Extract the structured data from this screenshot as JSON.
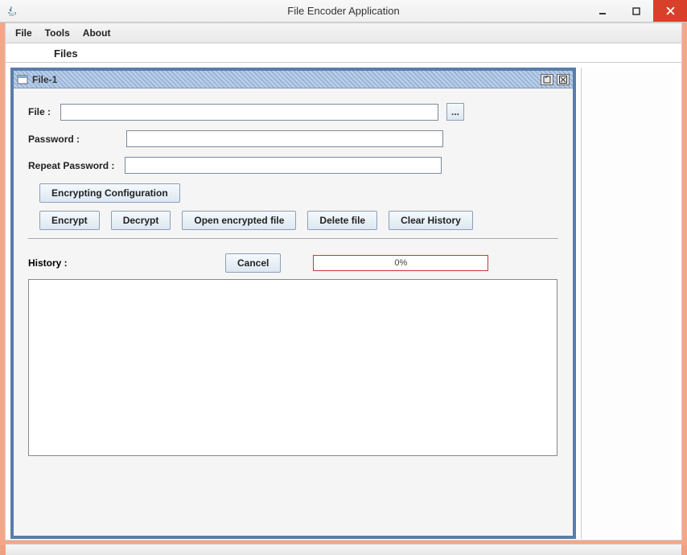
{
  "window": {
    "title": "File Encoder Application"
  },
  "menubar": {
    "items": [
      "File",
      "Tools",
      "About"
    ]
  },
  "tabbar": {
    "label": "Files"
  },
  "internalFrame": {
    "title": "File-1",
    "labels": {
      "file": "File :",
      "password": "Password :",
      "repeatPassword": "Repeat Password :",
      "history": "History :"
    },
    "inputs": {
      "file": "",
      "password": "",
      "repeatPassword": ""
    },
    "buttons": {
      "browse": "...",
      "encryptingConfig": "Encrypting Configuration",
      "encrypt": "Encrypt",
      "decrypt": "Decrypt",
      "openEncrypted": "Open encrypted file",
      "deleteFile": "Delete file",
      "clearHistory": "Clear History",
      "cancel": "Cancel"
    },
    "progress": {
      "text": "0%"
    }
  }
}
